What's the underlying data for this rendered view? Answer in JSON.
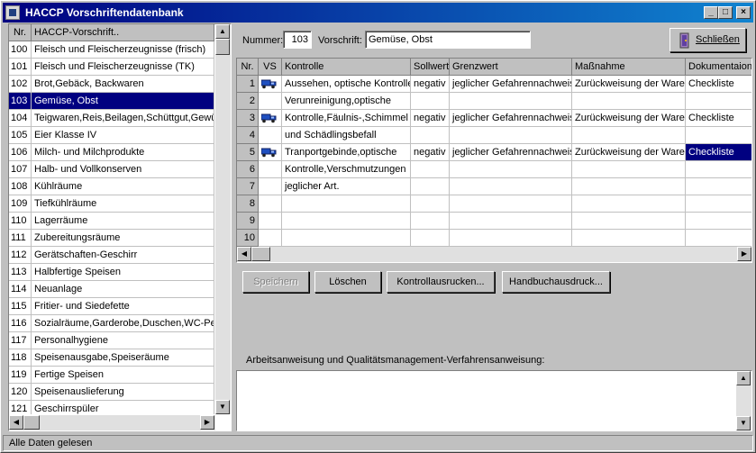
{
  "window": {
    "title": "HACCP Vorschriftendatenbank",
    "min": "_",
    "max": "□",
    "close": "×"
  },
  "left_list": {
    "headers": [
      "Nr.",
      "HACCP-Vorschrift.."
    ],
    "rows": [
      [
        "100",
        "Fleisch und Fleischerzeugnisse (frisch)"
      ],
      [
        "101",
        "Fleisch und Fleischerzeugnisse (TK)"
      ],
      [
        "102",
        "Brot,Gebäck, Backwaren"
      ],
      [
        "103",
        "Gemüse, Obst"
      ],
      [
        "104",
        "Teigwaren,Reis,Beilagen,Schüttgut,Gewü"
      ],
      [
        "105",
        "Eier Klasse IV"
      ],
      [
        "106",
        "Milch- und Milchprodukte"
      ],
      [
        "107",
        "Halb- und Vollkonserven"
      ],
      [
        "108",
        "Kühlräume"
      ],
      [
        "109",
        "Tiefkühlräume"
      ],
      [
        "110",
        "Lagerräume"
      ],
      [
        "111",
        "Zubereitungsräume"
      ],
      [
        "112",
        "Gerätschaften-Geschirr"
      ],
      [
        "113",
        "Halbfertige Speisen"
      ],
      [
        "114",
        "Neuanlage"
      ],
      [
        "115",
        "Fritier- und Siedefette"
      ],
      [
        "116",
        "Sozialräume,Garderobe,Duschen,WC-Pers"
      ],
      [
        "117",
        "Personalhygiene"
      ],
      [
        "118",
        "Speisenausgabe,Speiseräume"
      ],
      [
        "119",
        "Fertige Speisen"
      ],
      [
        "120",
        "Speisenauslieferung"
      ],
      [
        "121",
        "Geschirrspüler"
      ]
    ],
    "selected_row": "103"
  },
  "header_fields": {
    "nummer_label": "Nummer:",
    "nummer_value": "103",
    "vorschrift_label": "Vorschrift:",
    "vorschrift_value": "Gemüse, Obst",
    "close_button": "Schließen"
  },
  "main_grid": {
    "headers": [
      "Nr.",
      "VS",
      "Kontrolle",
      "Sollwert",
      "Grenzwert",
      "Maßnahme",
      "Dokumentaion"
    ],
    "rows": [
      {
        "nr": "1",
        "vs": true,
        "kontrolle": "Aussehen, optische Kontrolle",
        "sollwert": "negativ",
        "grenzwert": "jeglicher Gefahrennachweis",
        "massnahme": "Zurückweisung der Ware",
        "doku": "Checkliste"
      },
      {
        "nr": "2",
        "vs": false,
        "kontrolle": "Verunreinigung,optische",
        "sollwert": "",
        "grenzwert": "",
        "massnahme": "",
        "doku": ""
      },
      {
        "nr": "3",
        "vs": true,
        "kontrolle": "Kontrolle,Fäulnis-,Schimmel",
        "sollwert": "negativ",
        "grenzwert": "jeglicher Gefahrennachweis",
        "massnahme": "Zurückweisung der Ware",
        "doku": "Checkliste"
      },
      {
        "nr": "4",
        "vs": false,
        "kontrolle": "und Schädlingsbefall",
        "sollwert": "",
        "grenzwert": "",
        "massnahme": "",
        "doku": ""
      },
      {
        "nr": "5",
        "vs": true,
        "kontrolle": "Tranportgebinde,optische",
        "sollwert": "negativ",
        "grenzwert": "jeglicher Gefahrennachweis",
        "massnahme": "Zurückweisung der Ware",
        "doku": "Checkliste"
      },
      {
        "nr": "6",
        "vs": false,
        "kontrolle": "Kontrolle,Verschmutzungen",
        "sollwert": "",
        "grenzwert": "",
        "massnahme": "",
        "doku": ""
      },
      {
        "nr": "7",
        "vs": false,
        "kontrolle": "jeglicher Art.",
        "sollwert": "",
        "grenzwert": "",
        "massnahme": "",
        "doku": ""
      },
      {
        "nr": "8",
        "vs": false,
        "kontrolle": "",
        "sollwert": "",
        "grenzwert": "",
        "massnahme": "",
        "doku": ""
      },
      {
        "nr": "9",
        "vs": false,
        "kontrolle": "",
        "sollwert": "",
        "grenzwert": "",
        "massnahme": "",
        "doku": ""
      },
      {
        "nr": "10",
        "vs": false,
        "kontrolle": "",
        "sollwert": "",
        "grenzwert": "",
        "massnahme": "",
        "doku": ""
      }
    ],
    "selected_cell": {
      "row": "5",
      "column": "Dokumentaion"
    }
  },
  "buttons": {
    "speichern": "Speichern",
    "loeschen": "Löschen",
    "kontrollausdrucken": "Kontrollausrucken...",
    "handbuchausdruck": "Handbuchausdruck..."
  },
  "instruction": {
    "label": "Arbeitsanweisung und Qualitätsmanagement-Verfahrensanweisung:",
    "value": ""
  },
  "status": {
    "text": "Alle Daten gelesen"
  },
  "icons": {
    "vs_icon": "truck-icon",
    "close_icon": "door-exit-icon"
  },
  "colors": {
    "title_start": "#000080",
    "title_end": "#1084d0",
    "selection": "#000080",
    "face": "#c0c0c0"
  }
}
